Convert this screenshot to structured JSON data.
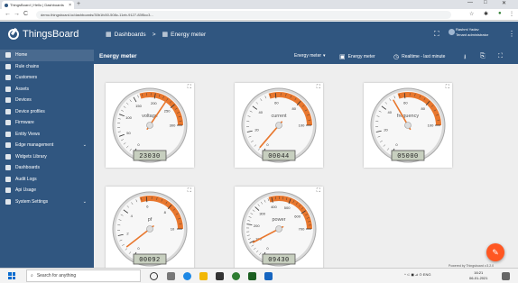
{
  "browser": {
    "tab_title": "ThingsBoard | Hello | Dashboards",
    "tab_close": "×",
    "new_tab": "+",
    "url": "demo.thingsboard.io/dashboards/30b1fc50-508c-11eb-9127-83f5cc3...",
    "back": "←",
    "forward": "→",
    "reload": "C",
    "window_min": "—",
    "window_max": "□",
    "window_close": "✕"
  },
  "toolbar": {
    "logo_text": "ThingsBoard",
    "crumb_dashboards": "Dashboards",
    "crumb_separator": ">",
    "crumb_current": "Energy meter",
    "user_name": "Rashmi Yadav",
    "user_role": "Tenant administrator",
    "fullscreen_icon": "⛶",
    "menu_icon": "⋮"
  },
  "sidebar": {
    "items": [
      {
        "label": "Home",
        "icon": "home-icon"
      },
      {
        "label": "Rule chains",
        "icon": "rule-chains-icon"
      },
      {
        "label": "Customers",
        "icon": "customers-icon"
      },
      {
        "label": "Assets",
        "icon": "assets-icon"
      },
      {
        "label": "Devices",
        "icon": "devices-icon"
      },
      {
        "label": "Device profiles",
        "icon": "device-profiles-icon"
      },
      {
        "label": "Firmware",
        "icon": "firmware-icon"
      },
      {
        "label": "Entity Views",
        "icon": "entity-views-icon"
      },
      {
        "label": "Edge management",
        "icon": "edge-icon",
        "chevron": "⌄"
      },
      {
        "label": "Widgets Library",
        "icon": "widgets-icon"
      },
      {
        "label": "Dashboards",
        "icon": "dashboards-icon"
      },
      {
        "label": "Audit Logs",
        "icon": "audit-logs-icon"
      },
      {
        "label": "Api Usage",
        "icon": "api-usage-icon"
      },
      {
        "label": "System Settings",
        "icon": "settings-icon",
        "chevron": "⌄"
      }
    ]
  },
  "dashboard": {
    "title": "Energy meter",
    "state_select": "Energy meter",
    "state_icon": "▾",
    "entity_label": "Energy meter",
    "timewindow": "Realtime - last minute",
    "download_icon": "⭳",
    "export_icon": "⎘",
    "fullscreen_icon": "⛶",
    "expand_icon": "⛶",
    "fab_icon": "✎",
    "powered_by": "Powered by Thingsboard v.3.2.0"
  },
  "gauges": [
    {
      "label": "voltage",
      "display": "23030",
      "value": 230,
      "max": 300,
      "ticks": [
        "0",
        "50",
        "100",
        "150",
        "200",
        "250",
        "300"
      ]
    },
    {
      "label": "current",
      "display": "00044",
      "value": 4.4,
      "max": 100,
      "ticks": [
        "0",
        "20",
        "40",
        "60",
        "80",
        "100"
      ]
    },
    {
      "label": "frequency",
      "display": "05000",
      "value": 50,
      "max": 100,
      "ticks": [
        "0",
        "20",
        "40",
        "60",
        "80",
        "100"
      ]
    },
    {
      "label": "pf",
      "display": "00092",
      "value": 0.92,
      "max": 10,
      "ticks": [
        "0",
        "2",
        "4",
        "6",
        "8",
        "10"
      ]
    },
    {
      "label": "power",
      "display": "09430",
      "value": 94.3,
      "max": 700,
      "ticks": [
        "0",
        "100",
        "200",
        "300",
        "400",
        "500",
        "600",
        "700"
      ]
    }
  ],
  "taskbar": {
    "search_placeholder": "Search for anything",
    "search_icon": "⌕",
    "tray_text": "^ ⊂ ◼ ⊿ ⊙ ENG",
    "time": "16:21",
    "date": "06-01-2021"
  },
  "colors": {
    "primary": "#305680",
    "accent": "#ff5722",
    "gauge_band": "#e8772e",
    "lcd": "#c7cfbf"
  }
}
